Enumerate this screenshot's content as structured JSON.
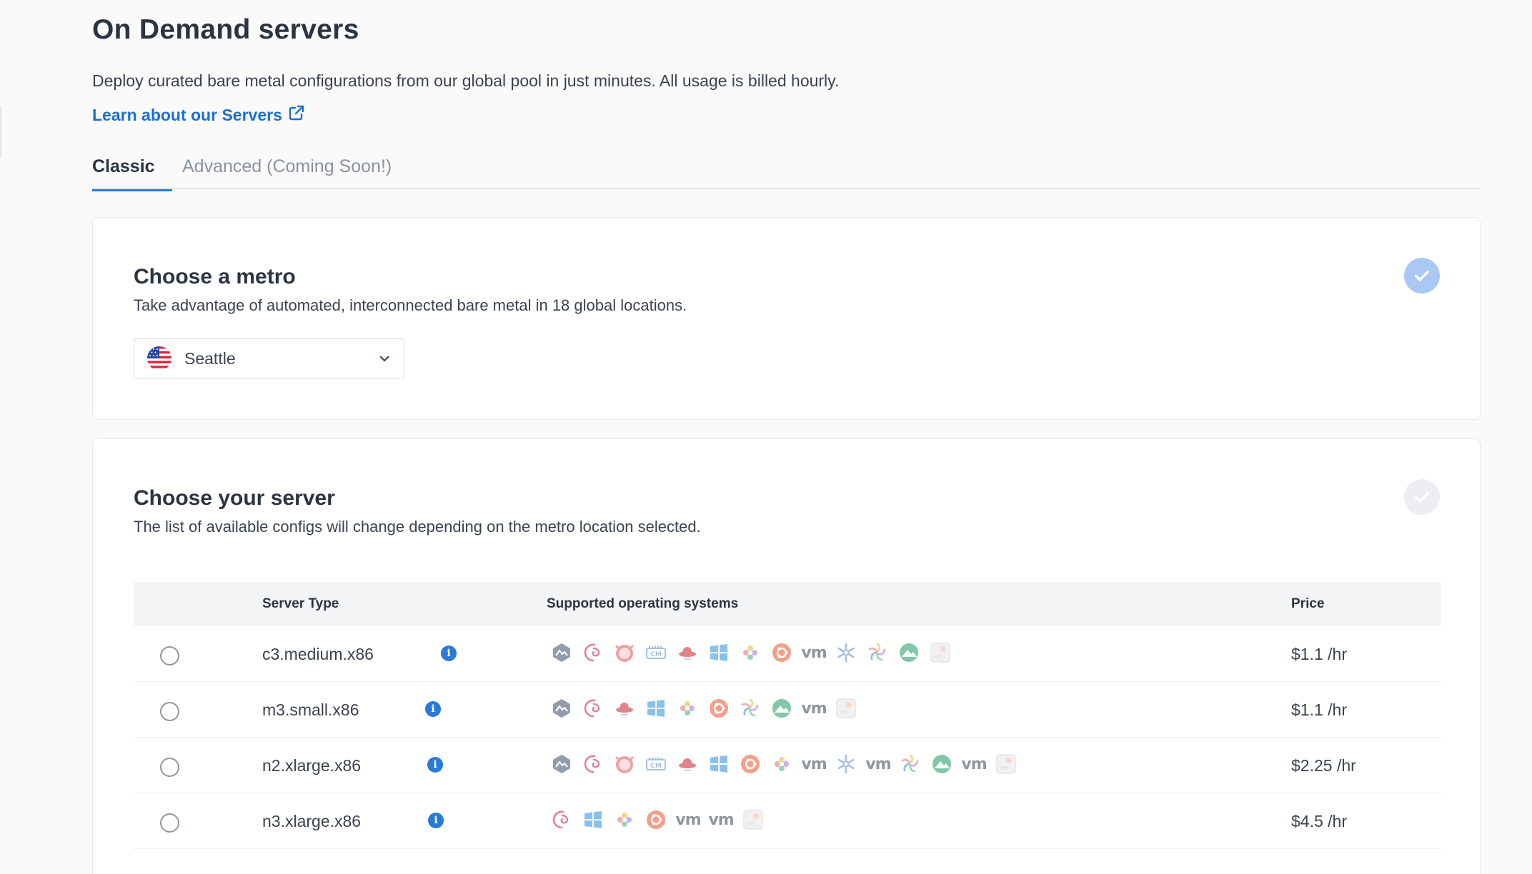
{
  "page": {
    "title": "On Demand servers",
    "description": "Deploy curated bare metal configurations from our global pool in just minutes. All usage is billed hourly.",
    "learn_link": "Learn about our Servers"
  },
  "tabs": [
    {
      "label": "Classic",
      "active": true
    },
    {
      "label": "Advanced (Coming Soon!)",
      "active": false
    }
  ],
  "metro": {
    "title": "Choose a metro",
    "subtitle": "Take advantage of automated, interconnected bare metal in 18 global locations.",
    "selected": "Seattle",
    "flag_icon": "us-flag-icon",
    "completed": true
  },
  "server": {
    "title": "Choose your server",
    "subtitle": "The list of available configs will change depending on the metro location selected.",
    "completed": false,
    "columns": {
      "type": "Server Type",
      "os": "Supported operating systems",
      "price": "Price"
    },
    "rows": [
      {
        "type": "c3.medium.x86",
        "price": "$1.1 /hr",
        "os": [
          "alma",
          "debian",
          "freebsd",
          "nixos",
          "redhat",
          "windows",
          "rocky",
          "ubuntu",
          "vm",
          "nixos-snow",
          "opensuse",
          "alpine",
          "custom"
        ]
      },
      {
        "type": "m3.small.x86",
        "price": "$1.1 /hr",
        "os": [
          "alma",
          "debian",
          "redhat",
          "windows",
          "rocky",
          "ubuntu",
          "opensuse",
          "alpine",
          "vm",
          "custom"
        ]
      },
      {
        "type": "n2.xlarge.x86",
        "price": "$2.25 /hr",
        "os": [
          "alma",
          "debian",
          "freebsd",
          "nixos",
          "redhat",
          "windows",
          "ubuntu",
          "rocky",
          "vm",
          "nixos-snow",
          "vm",
          "opensuse",
          "alpine",
          "vm",
          "custom"
        ]
      },
      {
        "type": "n3.xlarge.x86",
        "price": "$4.5 /hr",
        "os": [
          "debian",
          "windows",
          "rocky",
          "ubuntu",
          "vm",
          "vm",
          "custom"
        ]
      }
    ]
  },
  "colors": {
    "accent": "#2a7ad8",
    "link": "#1b6fd1",
    "check_active": "#a9c8f4",
    "check_inactive": "#eceef1"
  }
}
